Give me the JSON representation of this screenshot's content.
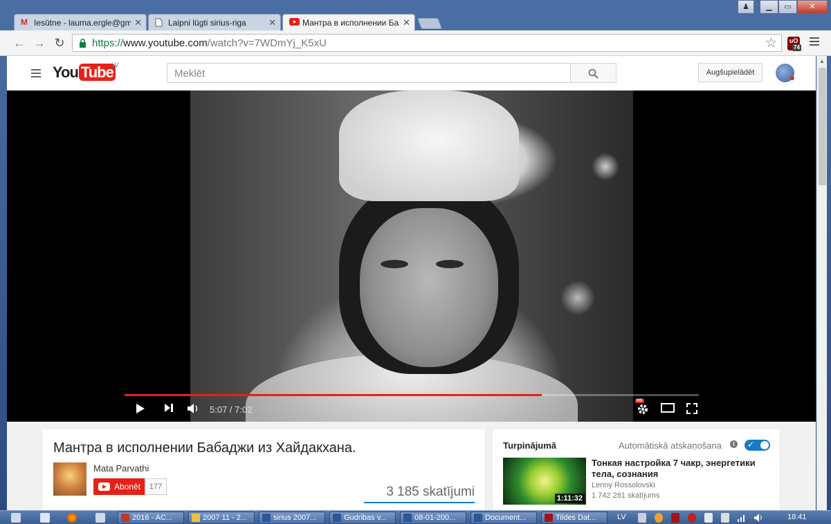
{
  "browser": {
    "tabs": [
      {
        "label": "Iesūtne - lauma.ergle@gm",
        "icon": "gmail-icon",
        "active": false
      },
      {
        "label": "Laipni lūgti sirius-riga",
        "icon": "page-icon",
        "active": false
      },
      {
        "label": "Мантра в исполнении Ба",
        "icon": "youtube-icon",
        "active": true
      }
    ],
    "tab_close": "✕",
    "url_scheme": "https://",
    "url_host": "www.youtube.com",
    "url_path": "/watch?v=7WDmYj_K5xU",
    "extension_badge": "74",
    "extension_label": "uO"
  },
  "youtube": {
    "logo_you": "You",
    "logo_tube": "Tube",
    "region": "LV",
    "search_placeholder": "Meklēt",
    "upload_label": "Augšupielādēt"
  },
  "player": {
    "time_current": "5:07",
    "time_total": "7:02",
    "time_display": "5:07 / 7:02",
    "progress_fraction": 0.727,
    "quality_badge": "HD"
  },
  "video": {
    "title": "Мантра в исполнении Бабаджи из Хайдакхана.",
    "channel": "Mata Parvathi",
    "subscribe_label": "Abonēt",
    "subscriber_count": "177",
    "views": "3 185 skatījumi"
  },
  "sidebar": {
    "up_next_label": "Turpinājumā",
    "autoplay_label": "Automātiskā atskaņošana",
    "autoplay_on": true,
    "next_video": {
      "title": "Тонкая настройка 7 чакр, энергетики тела, сознания",
      "channel": "Lenny Rossolovski",
      "views": "1 742 281 skatījums",
      "duration": "1:11:32"
    }
  },
  "taskbar": {
    "tasks": [
      {
        "label": "2016 - AC...",
        "color": "#c0392b"
      },
      {
        "label": "2007 11 - 2...",
        "color": "#f0c040"
      },
      {
        "label": "sirius 2007...",
        "color": "#2b5797"
      },
      {
        "label": "Gudribas v...",
        "color": "#2b5797"
      },
      {
        "label": "08-01-200...",
        "color": "#2b5797"
      },
      {
        "label": "Document...",
        "color": "#2b5797"
      },
      {
        "label": "Tildes Dat...",
        "color": "#a31515"
      }
    ],
    "language": "LV",
    "clock": "18:41"
  }
}
